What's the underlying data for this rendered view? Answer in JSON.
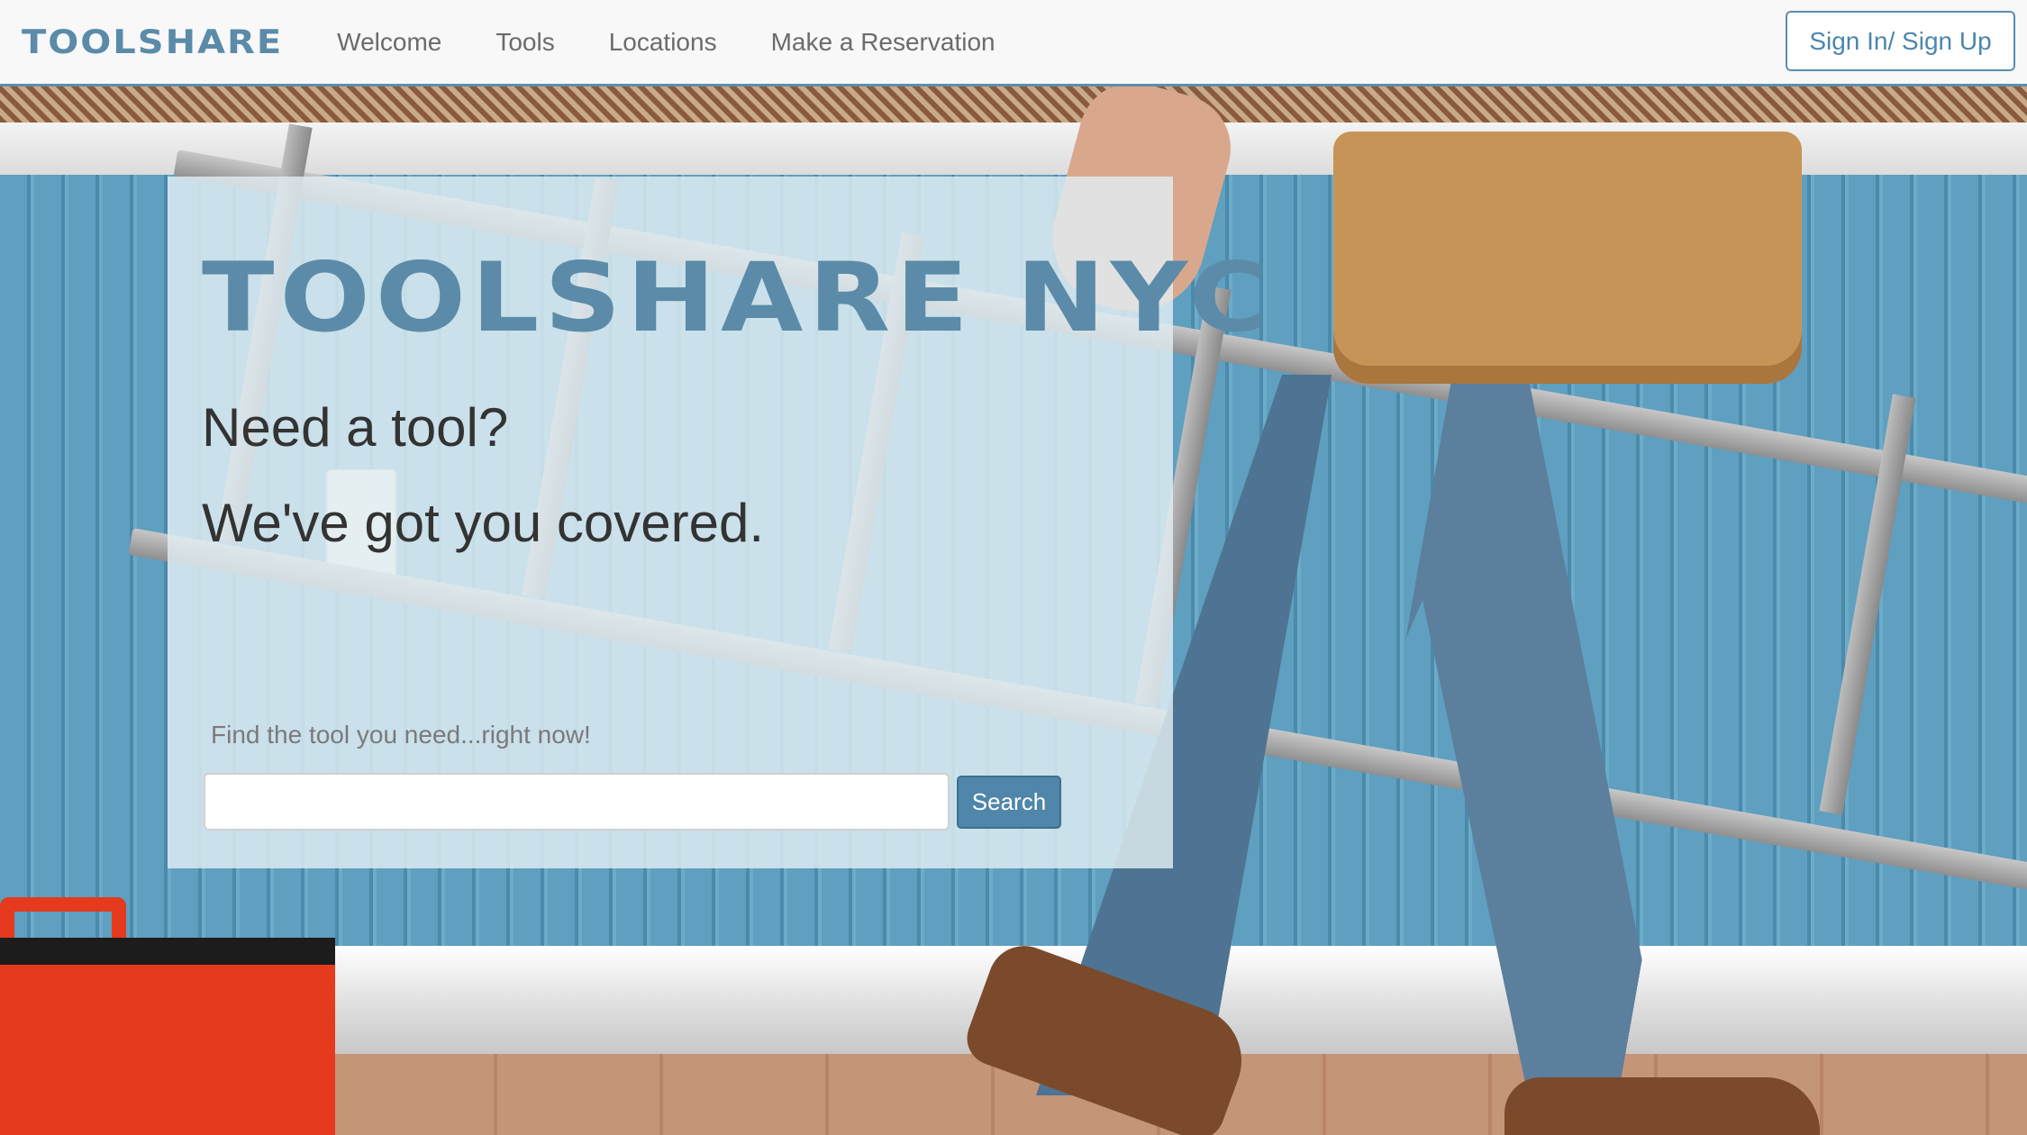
{
  "nav": {
    "brand": "TOOLSHARE",
    "links": [
      {
        "label": "Welcome"
      },
      {
        "label": "Tools"
      },
      {
        "label": "Locations"
      },
      {
        "label": "Make a Reservation"
      }
    ],
    "signin_label": "Sign In/ Sign Up"
  },
  "hero": {
    "title": "TOOLSHARE NYC",
    "tagline_1": "Need a tool?",
    "tagline_2": "We've got you covered.",
    "search_label": "Find the tool you need...right now!",
    "search_value": "",
    "search_button": "Search"
  },
  "colors": {
    "brand": "#5b8ba8",
    "accent": "#4f86a9",
    "nav_bg": "#f8f8f8"
  }
}
